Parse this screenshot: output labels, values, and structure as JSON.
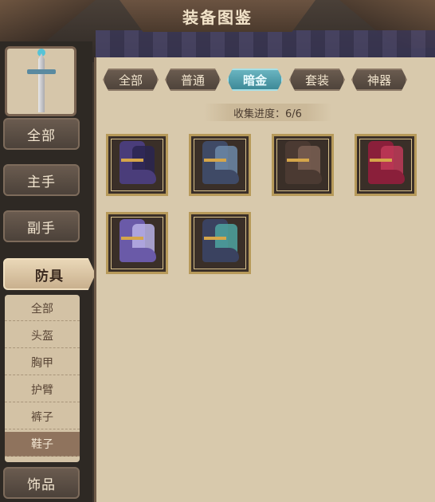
{
  "header": {
    "title": "装备图鉴"
  },
  "sidebar": {
    "weapon_slot_icon": "sword-icon",
    "categories": [
      {
        "label": "全部"
      },
      {
        "label": "主手"
      },
      {
        "label": "副手"
      },
      {
        "label": "防具",
        "active": true
      },
      {
        "label": "饰品"
      }
    ],
    "sub_items": [
      {
        "label": "全部"
      },
      {
        "label": "头盔"
      },
      {
        "label": "胸甲"
      },
      {
        "label": "护臂"
      },
      {
        "label": "裤子"
      },
      {
        "label": "鞋子",
        "active": true
      }
    ]
  },
  "tabs": [
    {
      "label": "全部"
    },
    {
      "label": "普通"
    },
    {
      "label": "暗金",
      "active": true
    },
    {
      "label": "套装"
    },
    {
      "label": "神器"
    }
  ],
  "progress": {
    "label": "收集进度：6/6"
  },
  "items": [
    {
      "icon": "spiked-dark-boots-icon",
      "color": "#4a3d7a",
      "accent": "#2a2550"
    },
    {
      "icon": "steel-blue-boots-icon",
      "color": "#3f4a66",
      "accent": "#6c88a8"
    },
    {
      "icon": "leather-brown-boots-icon",
      "color": "#4b3a32",
      "accent": "#7a5f52"
    },
    {
      "icon": "crimson-boots-icon",
      "color": "#8a1f3a",
      "accent": "#c03a58"
    },
    {
      "icon": "violet-armored-boots-icon",
      "color": "#6a5aa8",
      "accent": "#b9b2e6"
    },
    {
      "icon": "slate-runed-boots-icon",
      "color": "#3a4260",
      "accent": "#4ea3a0"
    }
  ],
  "colors": {
    "active_tab": "#3e8a98",
    "frame_gold": "#b79a5a"
  }
}
